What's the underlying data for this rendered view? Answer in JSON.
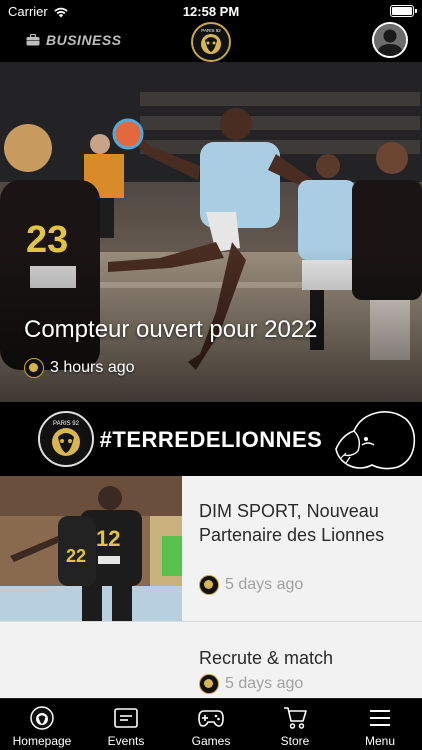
{
  "status": {
    "carrier": "Carrier",
    "time": "12:58 PM"
  },
  "header": {
    "business_label": "BUSINESS",
    "logo_text": "PARIS 92"
  },
  "hero": {
    "title": "Compteur ouvert pour 2022",
    "time_ago": "3 hours ago"
  },
  "banner": {
    "hashtag": "#TERREDELIONNES",
    "logo_text": "PARIS 92"
  },
  "news": [
    {
      "title": "DIM SPORT, Nouveau Partenaire des Lionnes",
      "time_ago": "5 days ago"
    },
    {
      "title": "Recrute & match",
      "time_ago": "5 days ago"
    }
  ],
  "tabs": [
    {
      "label": "Homepage",
      "icon": "home-logo-icon"
    },
    {
      "label": "Events",
      "icon": "events-icon"
    },
    {
      "label": "Games",
      "icon": "gamepad-icon"
    },
    {
      "label": "Store",
      "icon": "cart-icon"
    },
    {
      "label": "Menu",
      "icon": "menu-icon"
    }
  ],
  "colors": {
    "gold": "#c9a64a",
    "list_bg": "#f2f2f2",
    "meta_grey": "#a1a1a1"
  }
}
